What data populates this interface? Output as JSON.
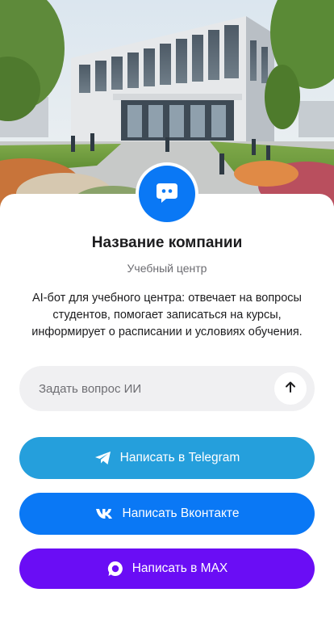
{
  "colors": {
    "accent_blue": "#0a78f5",
    "telegram": "#259fdc",
    "vkontakte": "#0a78f5",
    "max": "#6a0df5",
    "title": "#1c1c1e",
    "subtitle": "#6b6b70",
    "input_bg": "#f0f0f2"
  },
  "hero": {
    "icon": "campus-building-photo"
  },
  "profile": {
    "avatar_icon": "chat-bot-icon",
    "company_name": "Название компании",
    "category": "Учебный центр",
    "description": "AI-бот для учебного центра: отвечает на вопросы студентов, помогает записаться на курсы, информирует о расписании и условиях обучения."
  },
  "ask": {
    "placeholder": "Задать вопрос ИИ",
    "value": "",
    "send_icon": "arrow-up-icon"
  },
  "buttons": {
    "telegram": {
      "label": "Написать в Telegram",
      "icon": "telegram-icon"
    },
    "vkontakte": {
      "label": "Написать Вконтакте",
      "icon": "vk-icon"
    },
    "max": {
      "label": "Написать в MAX",
      "icon": "max-icon"
    }
  }
}
